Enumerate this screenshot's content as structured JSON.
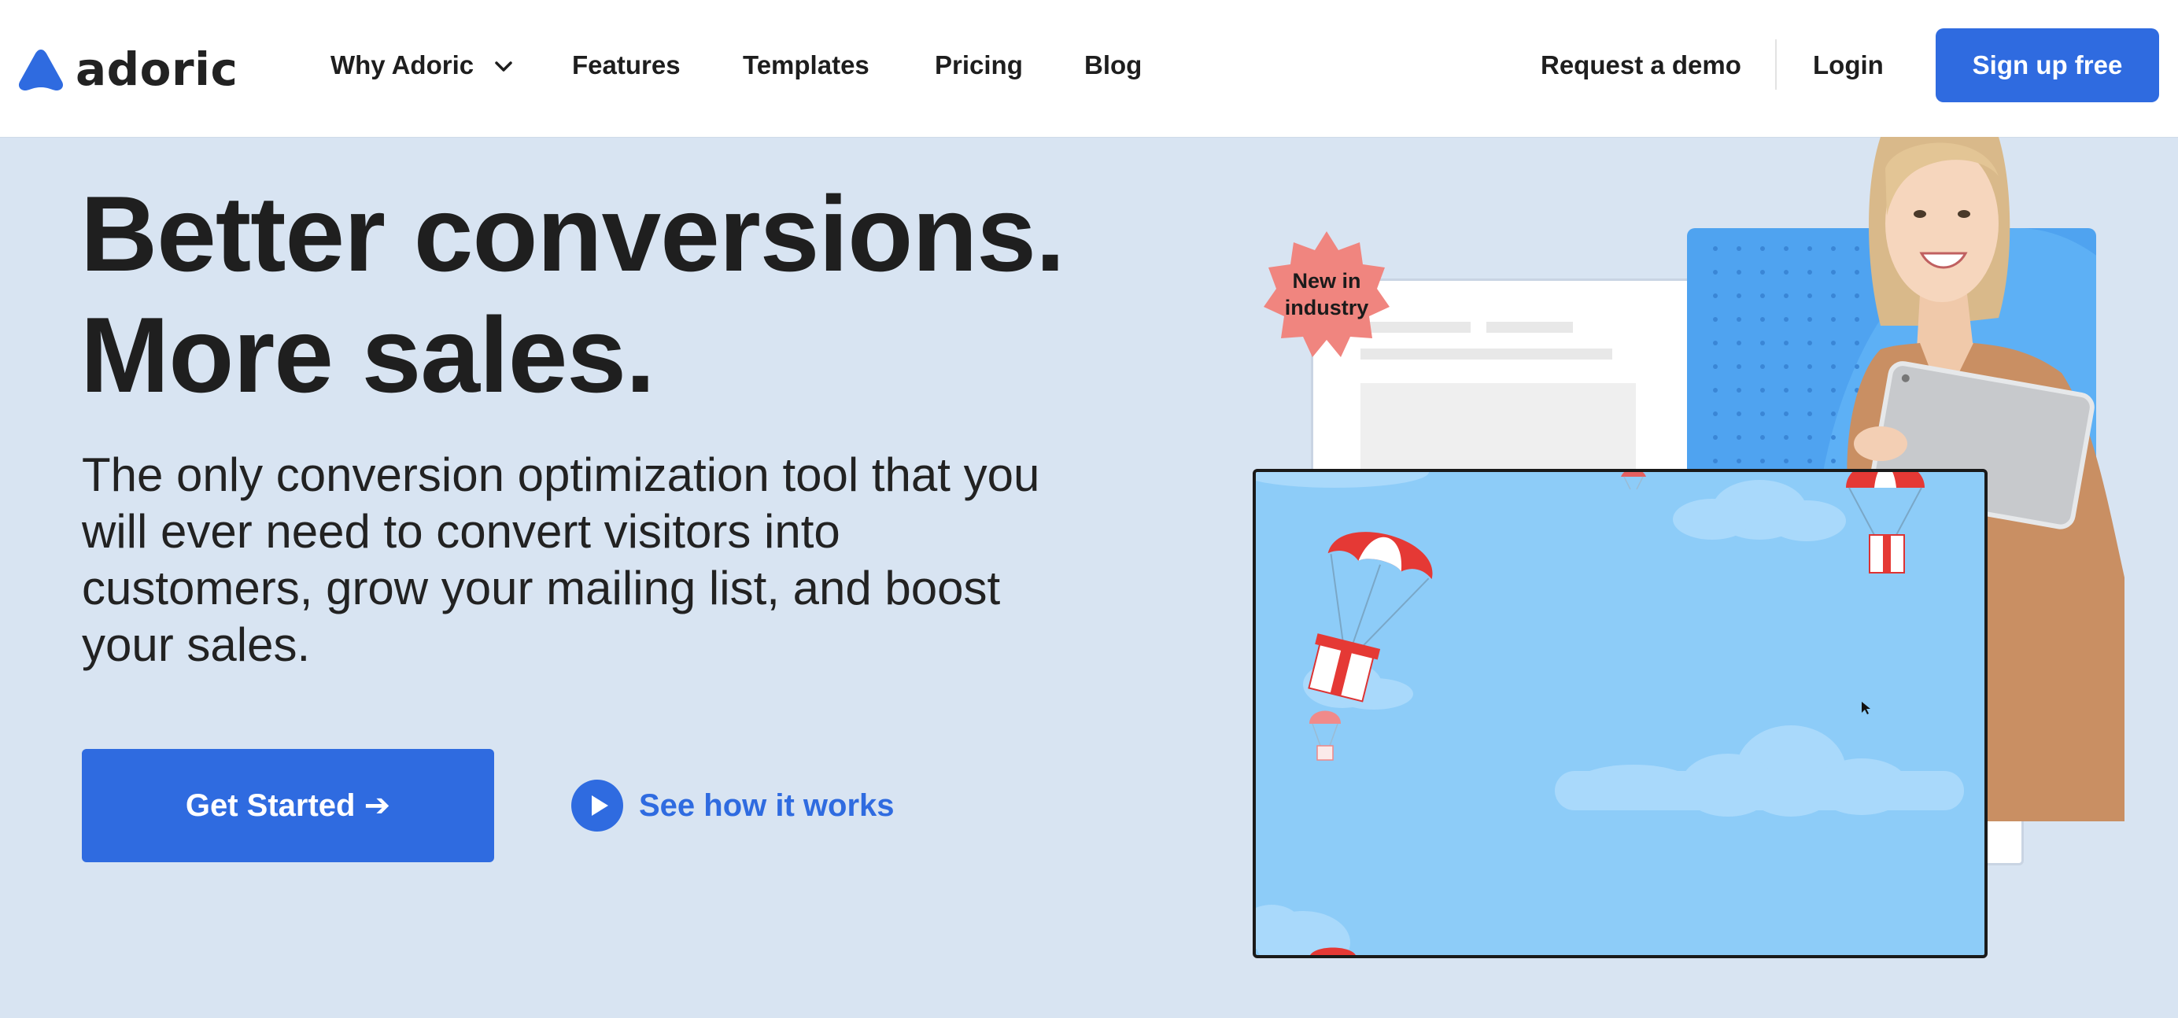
{
  "brand": {
    "name": "adoric",
    "accent": "#2f6be0",
    "background": "#d8e4f2"
  },
  "nav": {
    "items": [
      {
        "label": "Why Adoric",
        "has_dropdown": true
      },
      {
        "label": "Features"
      },
      {
        "label": "Templates"
      },
      {
        "label": "Pricing"
      },
      {
        "label": "Blog"
      }
    ],
    "request_demo": "Request a demo",
    "login": "Login",
    "signup": "Sign up free"
  },
  "hero": {
    "title_line1": "Better conversions.",
    "title_line2": "More sales.",
    "subtitle": "The only conversion optimization tool that you will ever need to convert visitors into customers, grow your mailing list, and boost your sales.",
    "cta_label": "Get Started ➔",
    "video_link": "See how it works"
  },
  "illustration": {
    "badge_line1": "New in",
    "badge_line2": "industry",
    "badge_color": "#f0857f",
    "sky_color": "#8dccf8",
    "card_color": "#4fa3f0"
  }
}
